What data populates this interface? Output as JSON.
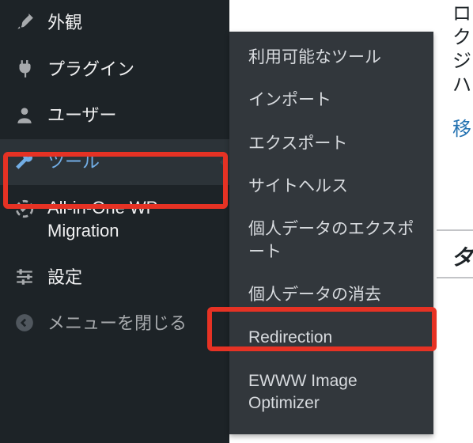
{
  "sidebar": {
    "items": [
      {
        "label": "外観"
      },
      {
        "label": "プラグイン"
      },
      {
        "label": "ユーザー"
      },
      {
        "label": "ツール"
      },
      {
        "label": "All-in-One WP Migration"
      },
      {
        "label": "設定"
      },
      {
        "label": "メニューを閉じる"
      }
    ]
  },
  "submenu": {
    "items": [
      "利用可能なツール",
      "インポート",
      "エクスポート",
      "サイトヘルス",
      "個人データのエクスポート",
      "個人データの消去",
      "Redirection",
      "EWWW Image Optimizer"
    ]
  },
  "content": {
    "line1": "ロ",
    "line2": "ク",
    "line3": "ジ",
    "line4": "ハ",
    "linkChar": "移",
    "boldChar": "タ"
  },
  "colors": {
    "highlight": "#e63224",
    "sidebarBg": "#1d2327",
    "submenuBg": "#32373c",
    "activeText": "#72aee6",
    "link": "#2271b1"
  }
}
